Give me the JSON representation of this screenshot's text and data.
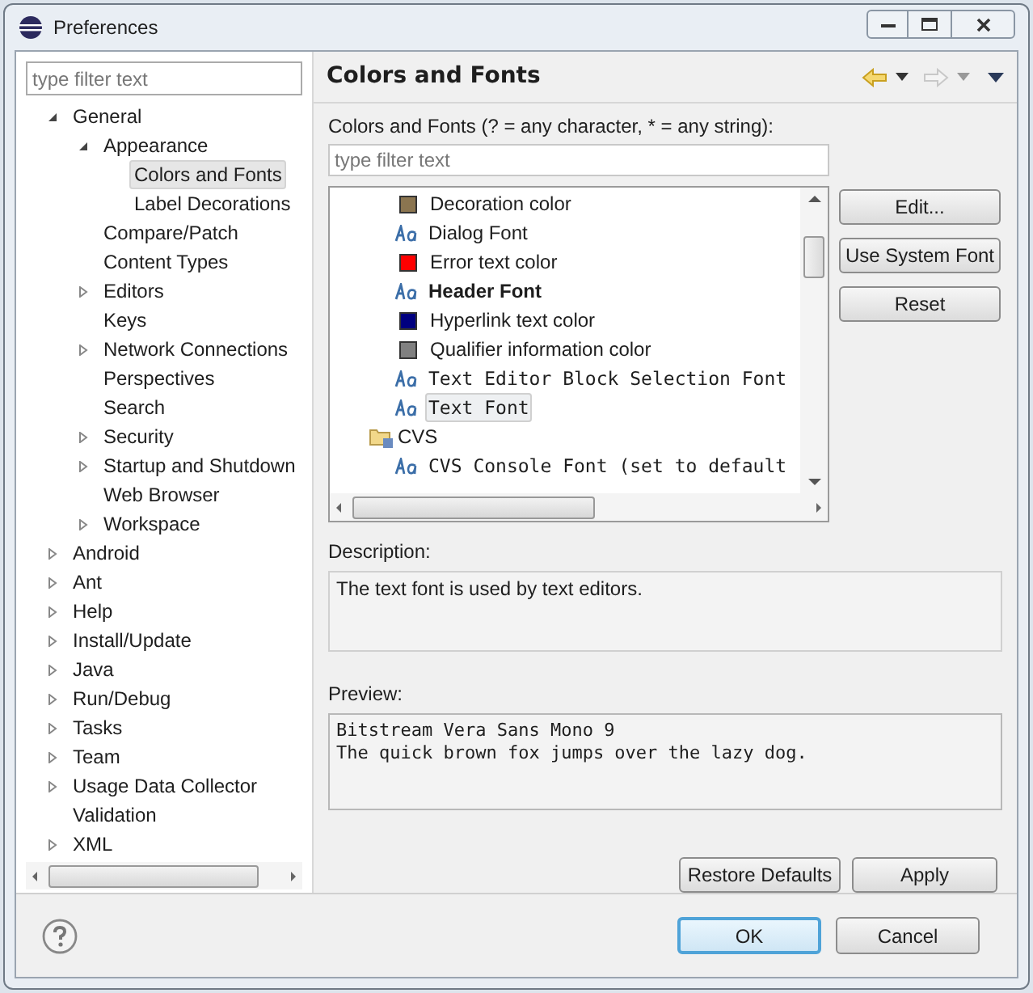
{
  "window": {
    "title": "Preferences"
  },
  "sidebar": {
    "filter": {
      "placeholder": "type filter text"
    },
    "tree": [
      {
        "label": "General",
        "expanded": true,
        "selected": false,
        "children": [
          {
            "label": "Appearance",
            "expanded": true,
            "selected": false,
            "children": [
              {
                "label": "Colors and Fonts",
                "selected": true
              },
              {
                "label": "Label Decorations",
                "selected": false
              }
            ]
          },
          {
            "label": "Compare/Patch",
            "selected": false
          },
          {
            "label": "Content Types",
            "selected": false
          },
          {
            "label": "Editors",
            "expanded": false,
            "selected": false
          },
          {
            "label": "Keys",
            "selected": false
          },
          {
            "label": "Network Connections",
            "expanded": false,
            "selected": false
          },
          {
            "label": "Perspectives",
            "selected": false
          },
          {
            "label": "Search",
            "selected": false
          },
          {
            "label": "Security",
            "expanded": false,
            "selected": false
          },
          {
            "label": "Startup and Shutdown",
            "expanded": false,
            "selected": false
          },
          {
            "label": "Web Browser",
            "selected": false
          },
          {
            "label": "Workspace",
            "expanded": false,
            "selected": false
          }
        ]
      },
      {
        "label": "Android",
        "expanded": false,
        "selected": false
      },
      {
        "label": "Ant",
        "expanded": false,
        "selected": false
      },
      {
        "label": "Help",
        "expanded": false,
        "selected": false
      },
      {
        "label": "Install/Update",
        "expanded": false,
        "selected": false
      },
      {
        "label": "Java",
        "expanded": false,
        "selected": false
      },
      {
        "label": "Run/Debug",
        "expanded": false,
        "selected": false
      },
      {
        "label": "Tasks",
        "expanded": false,
        "selected": false
      },
      {
        "label": "Team",
        "expanded": false,
        "selected": false
      },
      {
        "label": "Usage Data Collector",
        "expanded": false,
        "selected": false
      },
      {
        "label": "Validation",
        "selected": false
      },
      {
        "label": "XML",
        "expanded": false,
        "selected": false
      }
    ]
  },
  "page": {
    "title": "Colors and Fonts",
    "filter_label": "Colors and Fonts (? = any character, * = any string):",
    "filter": {
      "placeholder": "type filter text"
    },
    "entries": [
      {
        "kind": "color",
        "label": "Decoration color",
        "color": "#8b7550",
        "selected": false
      },
      {
        "kind": "font",
        "label": "Dialog Font",
        "bold": false,
        "mono": false,
        "selected": false
      },
      {
        "kind": "color",
        "label": "Error text color",
        "color": "#ff0000",
        "selected": false
      },
      {
        "kind": "font",
        "label": "Header Font",
        "bold": true,
        "mono": false,
        "selected": false
      },
      {
        "kind": "color",
        "label": "Hyperlink text color",
        "color": "#000080",
        "selected": false
      },
      {
        "kind": "color",
        "label": "Qualifier information color",
        "color": "#808080",
        "selected": false
      },
      {
        "kind": "font",
        "label": "Text Editor Block Selection Font",
        "bold": false,
        "mono": true,
        "selected": false
      },
      {
        "kind": "font",
        "label": "Text Font",
        "bold": false,
        "mono": true,
        "selected": true
      },
      {
        "kind": "category",
        "label": "CVS",
        "children": [
          {
            "kind": "font",
            "label": "CVS Console Font (set to default",
            "bold": false,
            "mono": true,
            "selected": false
          }
        ]
      }
    ],
    "side_buttons": [
      "Edit...",
      "Use System Font",
      "Reset"
    ],
    "description_label": "Description:",
    "description": "The text font is used by text editors.",
    "preview_label": "Preview:",
    "preview": [
      "Bitstream Vera Sans Mono 9",
      "The quick brown fox jumps over the lazy dog."
    ],
    "page_buttons": [
      "Restore Defaults",
      "Apply"
    ]
  },
  "buttons": [
    {
      "label": "OK",
      "default": true
    },
    {
      "label": "Cancel",
      "default": false
    }
  ]
}
